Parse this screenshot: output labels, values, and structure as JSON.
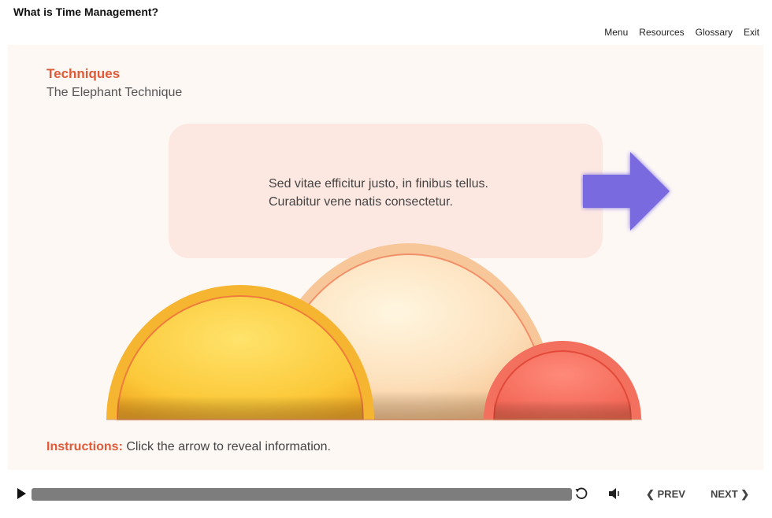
{
  "header": {
    "course_title": "What is Time Management?",
    "nav": [
      "Menu",
      "Resources",
      "Glossary",
      "Exit"
    ]
  },
  "slide": {
    "section_title": "Techniques",
    "section_subtitle": "The Elephant Technique",
    "info_text": "Sed vitae efficitur justo, in finibus tellus. Curabitur vene natis consectetur.",
    "instructions_label": "Instructions:",
    "instructions_text": " Click the arrow to reveal information.",
    "arrow_color": "#7a6ae0",
    "accent_color": "#e05a38"
  },
  "player": {
    "prev_label": "PREV",
    "next_label": "NEXT",
    "icons": [
      "play-icon",
      "replay-icon",
      "volume-icon",
      "chevron-left-icon",
      "chevron-right-icon"
    ]
  }
}
